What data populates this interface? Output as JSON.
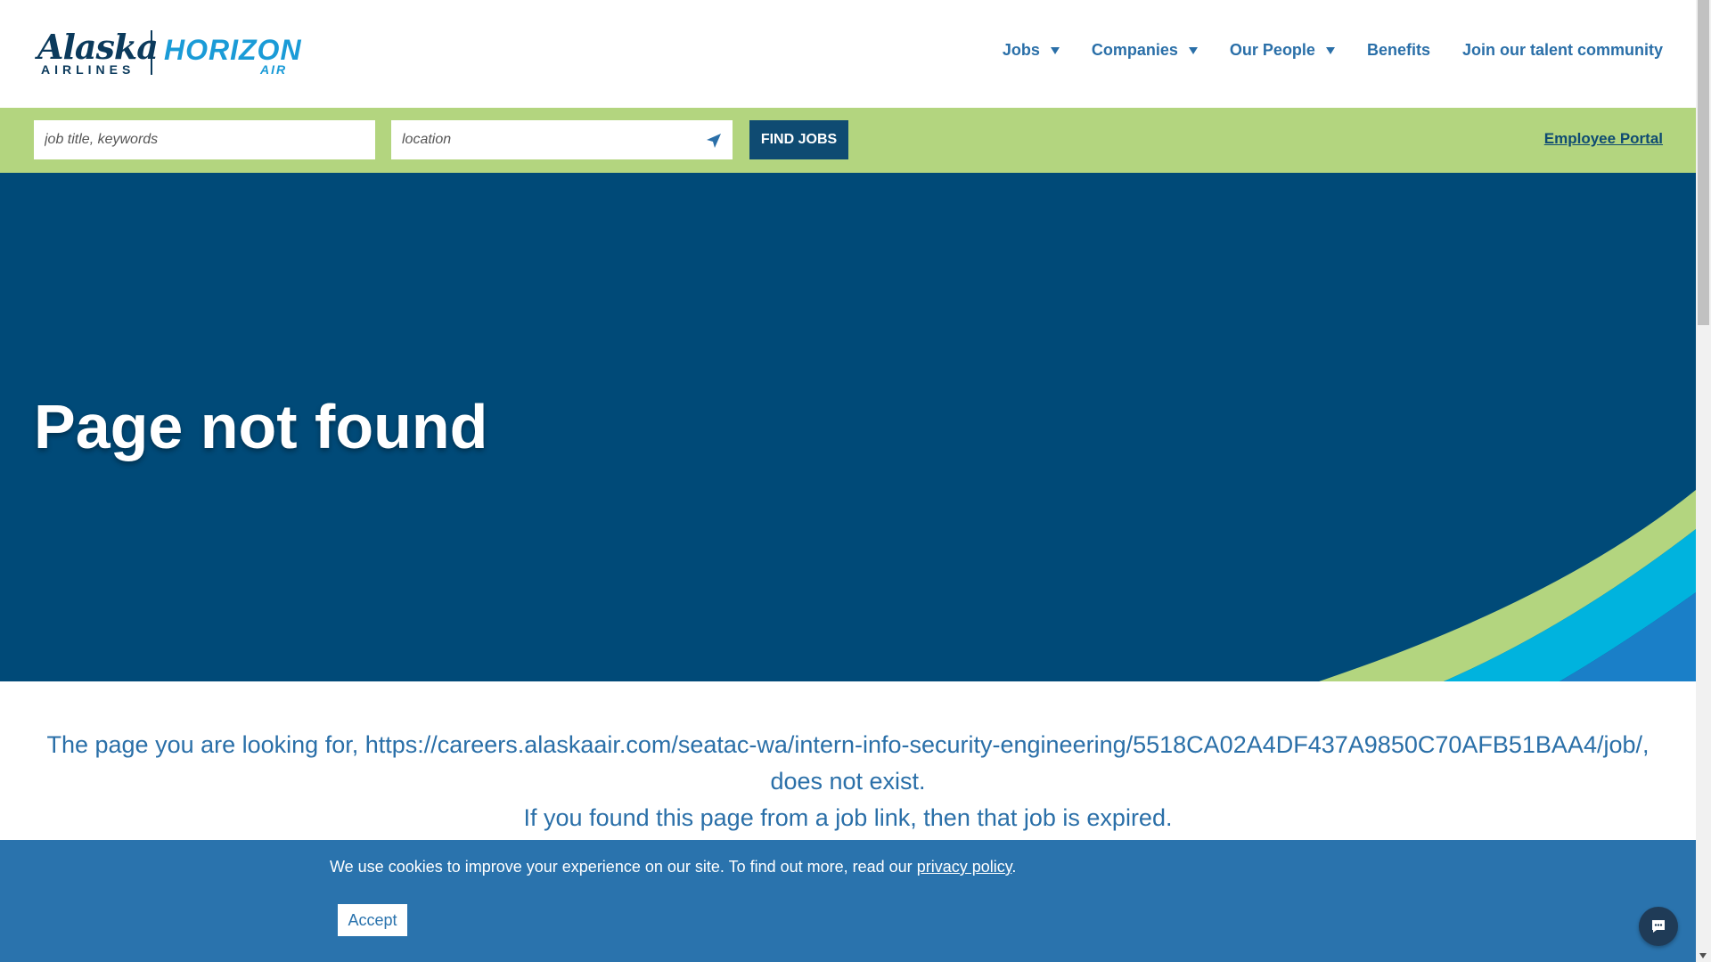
{
  "logo": {
    "alaska": "Alaska",
    "airlines": "AIRLINES",
    "horizon": "HORIZON",
    "air": "AIR"
  },
  "nav": {
    "jobs": "Jobs",
    "companies": "Companies",
    "our_people": "Our People",
    "benefits": "Benefits",
    "talent": "Join our talent community"
  },
  "search": {
    "keyword_placeholder": "job title, keywords",
    "location_placeholder": "location",
    "find_label": "FIND JOBS",
    "portal_label": "Employee Portal"
  },
  "hero": {
    "title": "Page not found"
  },
  "content": {
    "line1": "The page you are looking for, https://careers.alaskaair.com/seatac-wa/intern-info-security-engineering/5518CA02A4DF437A9850C70AFB51BAA4/job/,",
    "line2": "does not exist.",
    "line3": "If you found this page from a job link, then that job is expired."
  },
  "cookie": {
    "text": "We use cookies to improve your experience on our site. To find out more, read our ",
    "link": "privacy policy",
    "period": ".",
    "accept": "Accept"
  },
  "colors": {
    "navy": "#004a78",
    "green": "#b3d57f",
    "accent_blue": "#2a6fa8",
    "cookie_blue": "#2a73ad"
  },
  "icons": {
    "location": "location-arrow-icon",
    "chat": "chat-icon",
    "caret": "caret-down-icon"
  }
}
